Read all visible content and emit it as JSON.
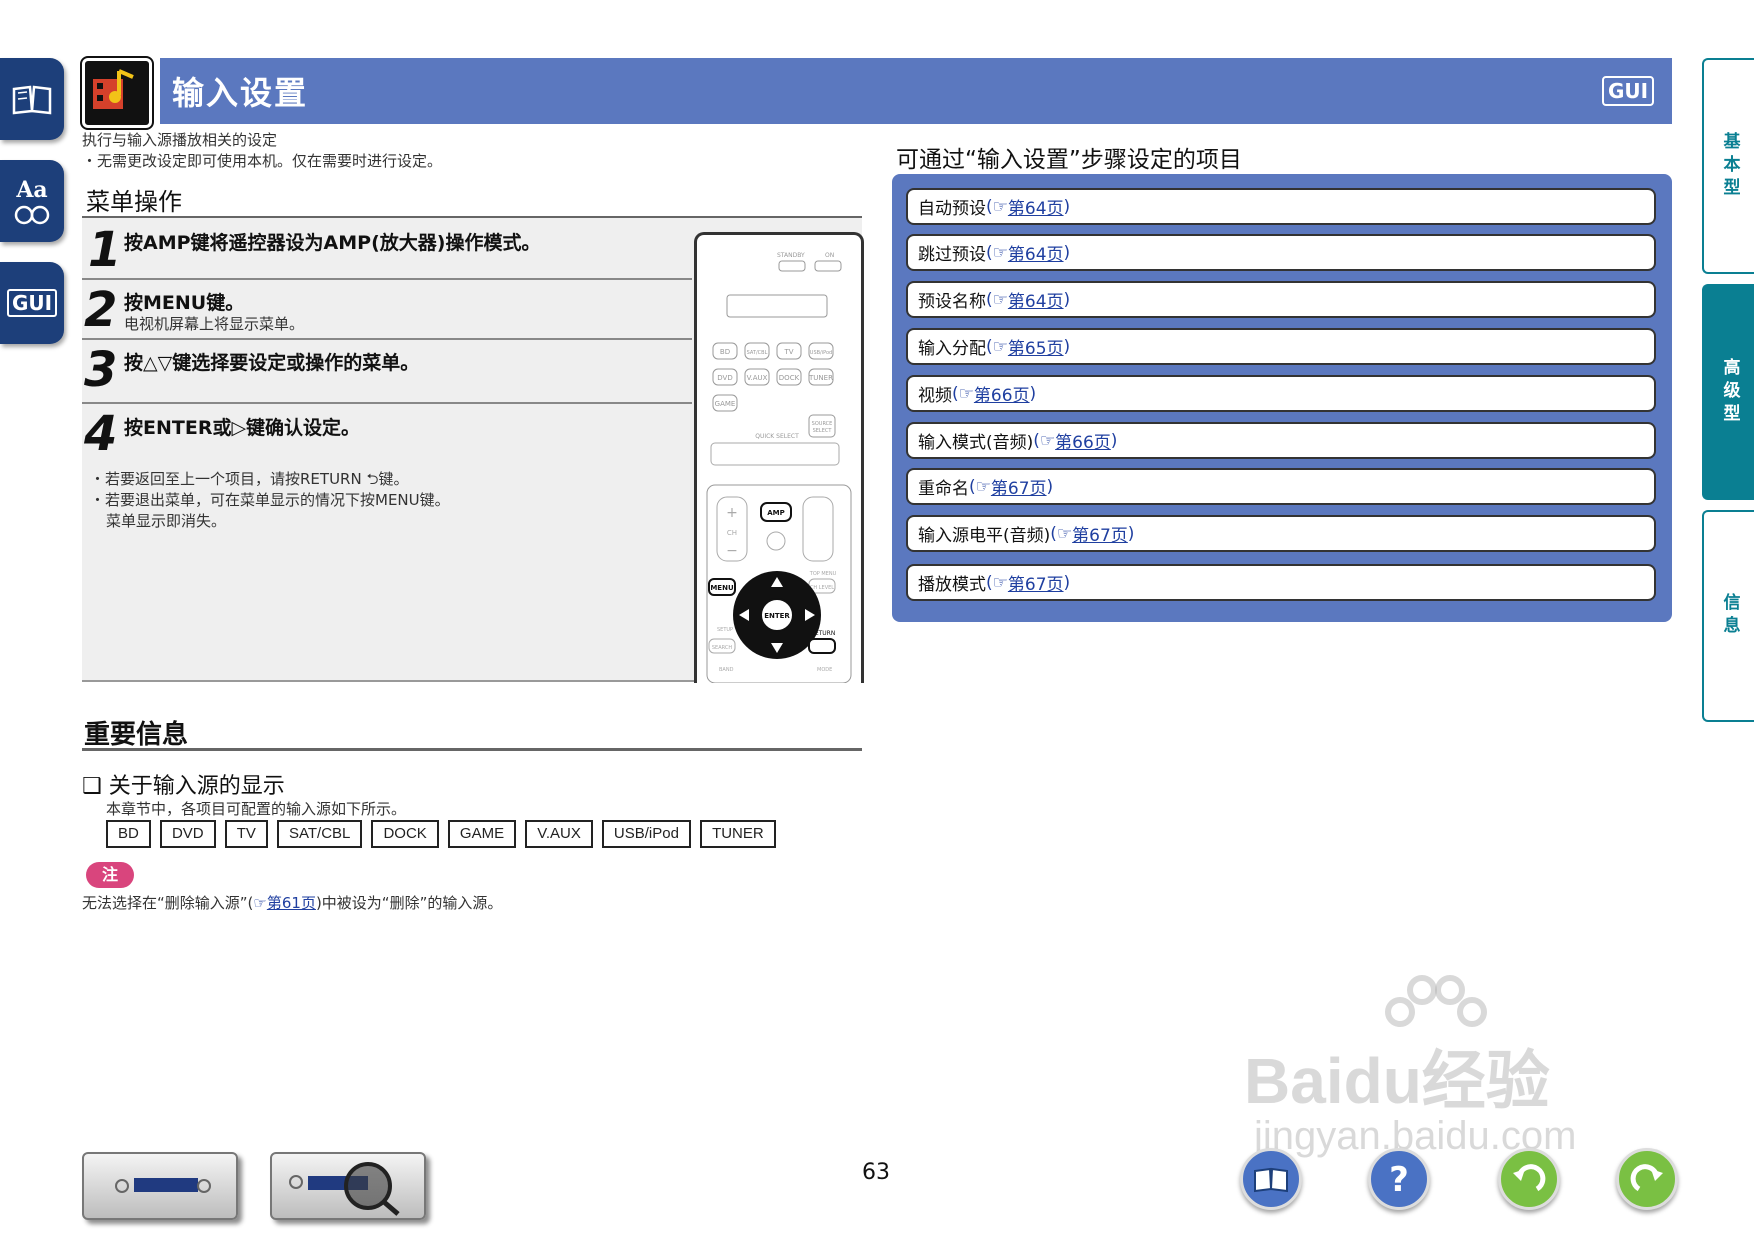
{
  "header": {
    "title": "输入设置",
    "badge": "GUI"
  },
  "left_tabs": [
    {
      "icon": "book-icon"
    },
    {
      "icon": "glossary-icon",
      "label": "Aa"
    },
    {
      "icon": "gui-icon",
      "label": "GUI"
    }
  ],
  "right_tabs": [
    {
      "label": "基本型",
      "active": false
    },
    {
      "label": "高级型",
      "active": true
    },
    {
      "label": "信息",
      "active": false
    }
  ],
  "intro": {
    "line1": "执行与输入源播放相关的设定",
    "line2": "・无需更改设定即可使用本机。仅在需要时进行设定。"
  },
  "menu_ops": {
    "title": "菜单操作",
    "steps": [
      {
        "num": "1",
        "text": "按AMP键将遥控器设为AMP(放大器)操作模式。",
        "sub": ""
      },
      {
        "num": "2",
        "text": "按MENU键。",
        "sub": "电视机屏幕上将显示菜单。"
      },
      {
        "num": "3",
        "text": "按△▽键选择要设定或操作的菜单。",
        "sub": ""
      },
      {
        "num": "4",
        "text": "按ENTER或▷键确认设定。",
        "sub": ""
      }
    ],
    "notes": [
      "・若要返回至上一个项目，请按RETURN ⮌键。",
      "・若要退出菜单，可在菜单显示的情况下按MENU键。",
      "菜单显示即消失。"
    ]
  },
  "remote": {
    "labels": [
      "STANDBY",
      "ON",
      "BD",
      "SAT/CBL",
      "TV",
      "USB/iPod",
      "DVD",
      "V.AUX",
      "DOCK",
      "TUNER",
      "GAME",
      "QUICK SELECT",
      "SOURCE SELECT",
      "CH",
      "AMP",
      "MENU",
      "ENTER",
      "RETURN",
      "TOP MENU",
      "CH LEVEL",
      "SETUP",
      "SEARCH",
      "BAND",
      "MODE"
    ]
  },
  "settings_list": {
    "title": "可通过“输入设置”步骤设定的项目",
    "items": [
      {
        "label": "自动预设",
        "ref": "第64页"
      },
      {
        "label": "跳过预设",
        "ref": "第64页"
      },
      {
        "label": "预设名称",
        "ref": "第64页"
      },
      {
        "label": "输入分配",
        "ref": "第65页"
      },
      {
        "label": "视频",
        "ref": "第66页"
      },
      {
        "label": "输入模式(音频)",
        "ref": "第66页"
      },
      {
        "label": "重命名",
        "ref": "第67页"
      },
      {
        "label": "输入源电平(音频)",
        "ref": "第67页"
      },
      {
        "label": "播放模式",
        "ref": "第67页"
      }
    ]
  },
  "important": {
    "title": "重要信息",
    "subtitle": "❑ 关于输入源的显示",
    "desc": "本章节中，各项目可配置的输入源如下所示。",
    "sources": [
      "BD",
      "DVD",
      "TV",
      "SAT/CBL",
      "DOCK",
      "GAME",
      "V.AUX",
      "USB/iPod",
      "TUNER"
    ]
  },
  "note": {
    "badge": "注",
    "text_before": "无法选择在“删除输入源”(",
    "ref": "第61页",
    "text_after": ")中被设为“删除”的输入源。"
  },
  "page_number": "63",
  "watermark": {
    "main": "Baidu经验",
    "url": "jingyan.baidu.com"
  },
  "bottom_buttons": [
    "book-icon",
    "help-icon",
    "back-icon",
    "forward-icon"
  ],
  "colors": {
    "header_blue": "#5b78bf",
    "tab_teal": "#0a7f92",
    "nav_blue": "#1d3f7a",
    "note_pink": "#d9457d",
    "link_blue": "#1f3fa0"
  }
}
